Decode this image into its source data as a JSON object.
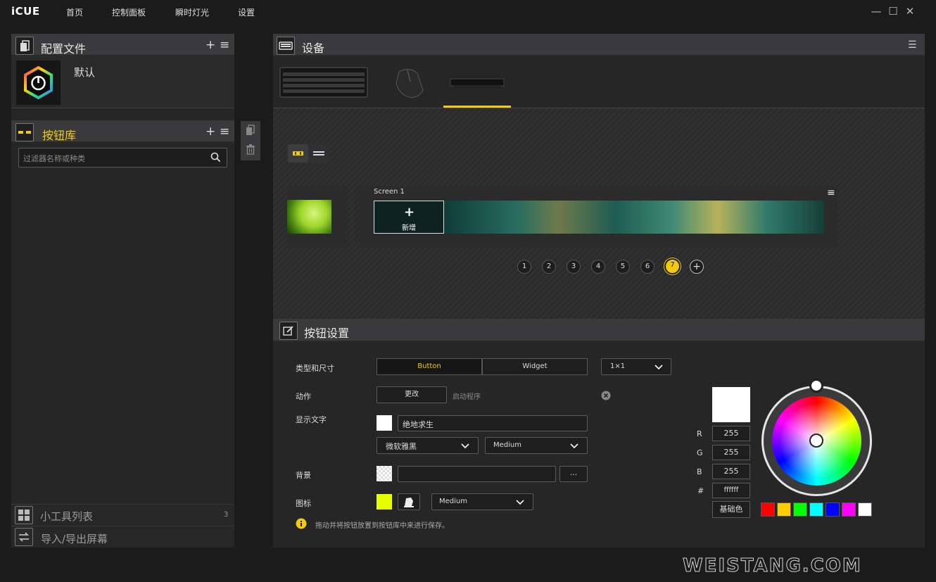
{
  "app": {
    "logo": "iCUE"
  },
  "nav": {
    "home": "首页",
    "dashboard": "控制面板",
    "instant_lighting": "瞬时灯光",
    "settings": "设置"
  },
  "window": {
    "minimize": "—",
    "maximize": "☐",
    "close": "✕"
  },
  "profiles": {
    "title": "配置文件",
    "add": "+",
    "menu": "≡",
    "items": [
      {
        "name": "默认"
      }
    ]
  },
  "button_library": {
    "title": "按钮库",
    "add": "+",
    "menu": "≡",
    "filter_placeholder": "过滤器名称或种类"
  },
  "widget_list": {
    "title": "小工具列表",
    "count": "3"
  },
  "import_export": {
    "title": "导入/导出屏幕"
  },
  "devices": {
    "title": "设备",
    "menu": "☰"
  },
  "screen": {
    "label": "Screen 1",
    "new_tile_plus": "+",
    "new_tile_label": "新增",
    "menu": "≡"
  },
  "pages": {
    "items": [
      "1",
      "2",
      "3",
      "4",
      "5",
      "6",
      "7"
    ],
    "active": "7",
    "add": "+"
  },
  "button_settings": {
    "title": "按钮设置",
    "type_size_label": "类型和尺寸",
    "type_button": "Button",
    "type_widget": "Widget",
    "size_value": "1×1",
    "action_label": "动作",
    "action_button": "更改",
    "action_value": "启动程序",
    "display_text_label": "显示文字",
    "display_text_value": "绝地求生",
    "font_value": "微软雅黑",
    "font_size_value": "Medium",
    "background_label": "背景",
    "background_browse": "...",
    "icon_label": "图标",
    "icon_size_value": "Medium",
    "hint": "拖动并将按钮放置到按钮库中来进行保存。"
  },
  "color": {
    "r_label": "R",
    "r": "255",
    "g_label": "G",
    "g": "255",
    "b_label": "B",
    "b": "255",
    "hex_label": "#",
    "hex": "ffffff",
    "basic_button": "基础色",
    "swatches": [
      "#ff0000",
      "#ffcc00",
      "#00ff00",
      "#00ffff",
      "#0000ff",
      "#ff00ff",
      "#ffffff"
    ],
    "accent": "#f2cb10"
  },
  "watermark": "WEISTANG.COM"
}
